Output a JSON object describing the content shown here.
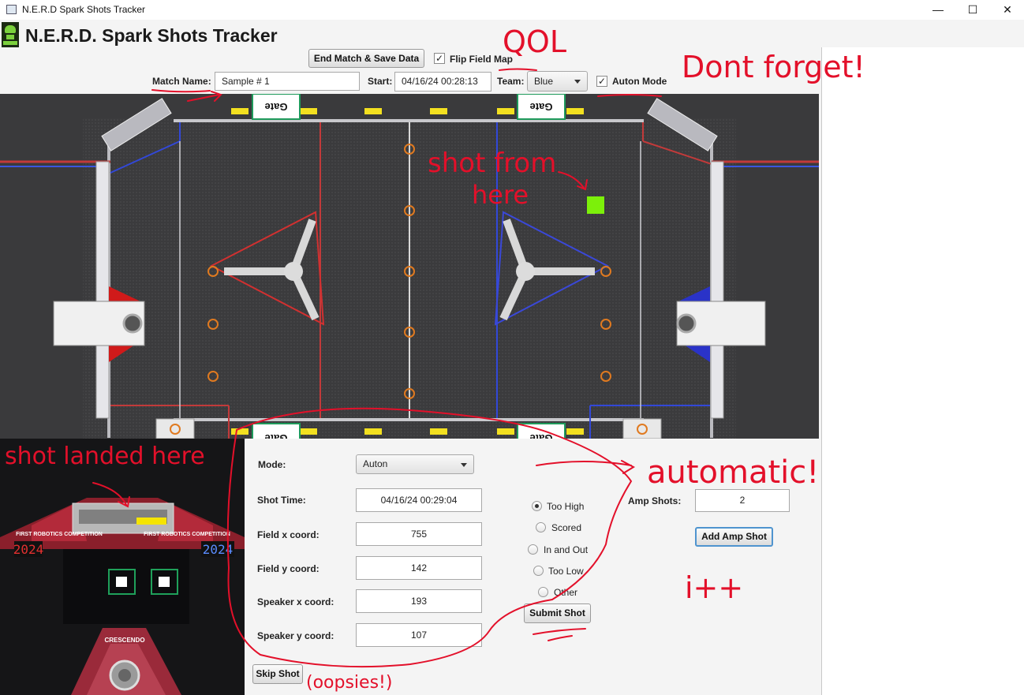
{
  "window": {
    "title": "N.E.R.D Spark Shots Tracker",
    "controls": {
      "minimize": "—",
      "maximize": "☐",
      "close": "✕"
    }
  },
  "header": {
    "app_title": "N.E.R.D. Spark Shots Tracker",
    "end_match_label": "End Match & Save Data",
    "flip_field_label": "Flip Field Map",
    "flip_field_checked": true
  },
  "match": {
    "name_label": "Match Name:",
    "name_value": "Sample # 1",
    "start_label": "Start:",
    "start_value": "04/16/24 00:28:13",
    "team_label": "Team:",
    "team_value": "Blue",
    "auton_label": "Auton Mode",
    "auton_checked": true
  },
  "field_map": {
    "gate_label": "Gate",
    "marker_color": "#7cf00a"
  },
  "form": {
    "mode_label": "Mode:",
    "mode_value": "Auton",
    "shot_time_label": "Shot Time:",
    "shot_time_value": "04/16/24 00:29:04",
    "field_x_label": "Field x coord:",
    "field_x_value": "755",
    "field_y_label": "Field y coord:",
    "field_y_value": "142",
    "speaker_x_label": "Speaker x coord:",
    "speaker_x_value": "193",
    "speaker_y_label": "Speaker y coord:",
    "speaker_y_value": "107",
    "skip_label": "Skip Shot",
    "submit_label": "Submit Shot",
    "results": [
      {
        "label": "Too High",
        "selected": true
      },
      {
        "label": "Scored",
        "selected": false
      },
      {
        "label": "In and Out",
        "selected": false
      },
      {
        "label": "Too Low",
        "selected": false
      },
      {
        "label": "Other",
        "selected": false
      }
    ]
  },
  "amp": {
    "label": "Amp Shots:",
    "value": "2",
    "add_label": "Add Amp Shot"
  },
  "speaker_image": {
    "year_left": "2024",
    "year_right": "2024",
    "brand": "FIRST ROBOTICS COMPETITION",
    "crescendo": "CRESCENDO",
    "marker_color": "#f5e400"
  },
  "annotations": {
    "qol": "QOL",
    "dont_forget": "Dont forget!",
    "shot_from": "shot from",
    "here": "here",
    "shot_landed": "shot landed here",
    "automatic": "automatic!",
    "ipp": "i++",
    "oopsies": "(oopsies!)",
    "color": "#e3102a"
  }
}
